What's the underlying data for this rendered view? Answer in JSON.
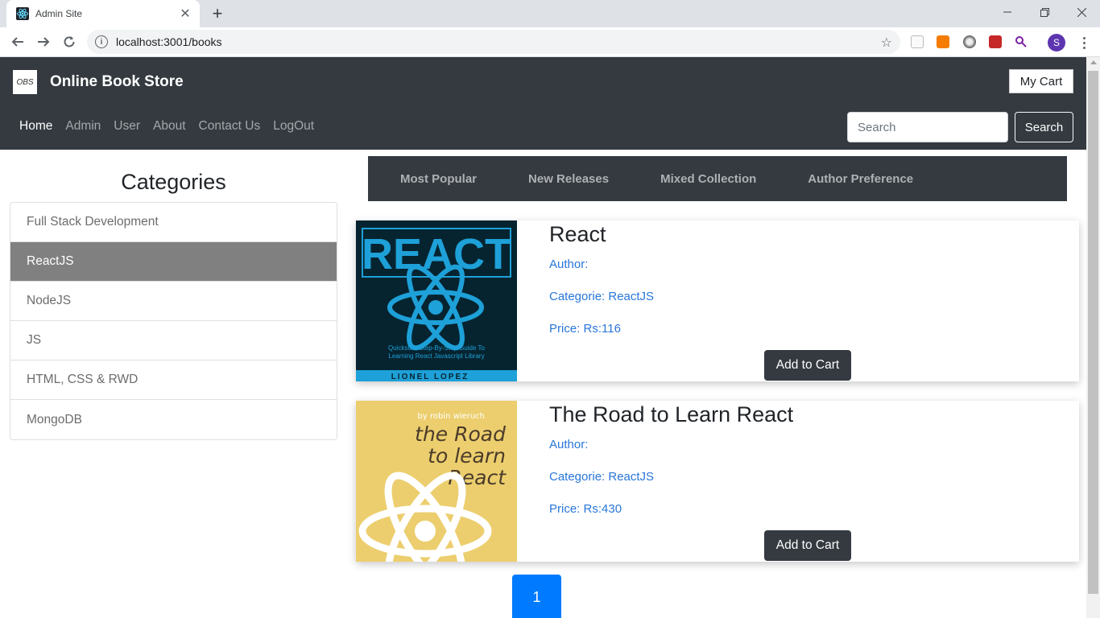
{
  "browser": {
    "tab_title": "Admin Site",
    "new_tab": "+",
    "url": "localhost:3001/books",
    "profile_initial": "S",
    "window_controls": [
      "minimize-icon",
      "restore-icon",
      "close-icon"
    ],
    "nav_icons": [
      "back-arrow-icon",
      "forward-arrow-icon",
      "reload-icon"
    ],
    "extension_icons": [
      "bookmark-ext-icon",
      "orange-ext-icon",
      "gray-circle-ext-icon",
      "red-ext-icon",
      "search-ext-icon"
    ]
  },
  "header": {
    "logo_text": "OBS",
    "brand": "Online Book Store",
    "cart_button": "My Cart",
    "nav_links": [
      "Home",
      "Admin",
      "User",
      "About",
      "Contact Us",
      "LogOut"
    ],
    "active_nav": "Home",
    "search_placeholder": "Search",
    "search_button": "Search"
  },
  "sidebar": {
    "title": "Categories",
    "items": [
      "Full Stack Development",
      "ReactJS",
      "NodeJS",
      "JS",
      "HTML, CSS & RWD",
      "MongoDB"
    ],
    "active_item": "ReactJS"
  },
  "filter_tabs": [
    "Most Popular",
    "New Releases",
    "Mixed Collection",
    "Author Preference"
  ],
  "books": [
    {
      "title": "React",
      "author": "Author:",
      "category": "Categorie: ReactJS",
      "price": "Price: Rs:116",
      "button": "Add to Cart",
      "cover": {
        "heading": "REACT",
        "subtitle_line1": "Quickstart Step-By-Step Guide To",
        "subtitle_line2": "Learning React Javascript Library",
        "author_band": "LIONEL LOPEZ"
      }
    },
    {
      "title": "The Road to Learn React",
      "author": "Author:",
      "category": "Categorie: ReactJS",
      "price": "Price: Rs:430",
      "button": "Add to Cart",
      "cover": {
        "byline": "by robin wieruch",
        "line1": "the Road",
        "line2": "to learn",
        "line3": "React"
      }
    }
  ],
  "pagination": {
    "current": "1"
  },
  "colors": {
    "navbar": "#343a40",
    "active_category": "#808080",
    "link_blue": "#2876d8",
    "pager_blue": "#007bff",
    "react_cover_bg": "#062430",
    "react_cover_accent": "#1ea0d8",
    "road_cover_bg": "#ecce6e"
  }
}
